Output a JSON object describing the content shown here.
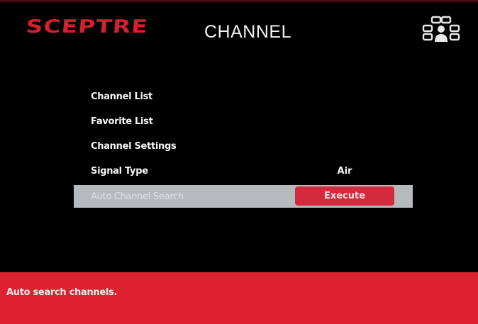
{
  "brand": {
    "logo_text": "SCEPTRE",
    "accent_color": "#d2202f"
  },
  "header": {
    "title": "CHANNEL",
    "icon": "channel-network-icon"
  },
  "menu": {
    "items": [
      {
        "label": "Channel List",
        "value": ""
      },
      {
        "label": "Favorite List",
        "value": ""
      },
      {
        "label": "Channel Settings",
        "value": ""
      },
      {
        "label": "Signal Type",
        "value": "Air"
      },
      {
        "label": "Auto Channel Search",
        "button": "Execute",
        "selected": true
      }
    ]
  },
  "help": {
    "text": "Auto search channels.",
    "bar_color": "#dc2230"
  }
}
